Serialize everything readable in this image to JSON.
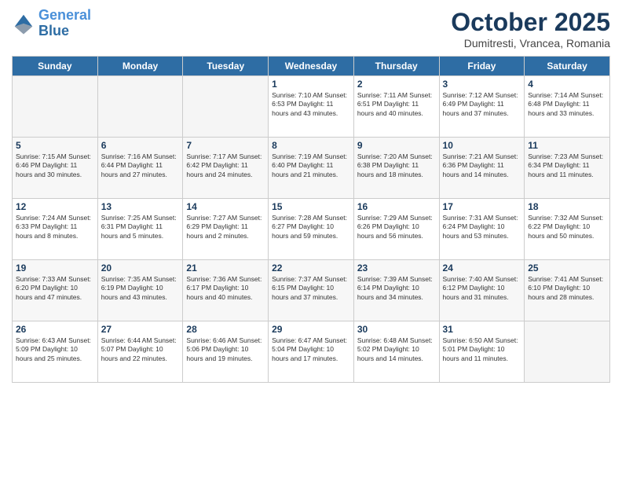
{
  "logo": {
    "line1": "General",
    "line2": "Blue"
  },
  "title": "October 2025",
  "subtitle": "Dumitresti, Vrancea, Romania",
  "days_of_week": [
    "Sunday",
    "Monday",
    "Tuesday",
    "Wednesday",
    "Thursday",
    "Friday",
    "Saturday"
  ],
  "weeks": [
    [
      {
        "num": "",
        "empty": true
      },
      {
        "num": "",
        "empty": true
      },
      {
        "num": "",
        "empty": true
      },
      {
        "num": "1",
        "info": "Sunrise: 7:10 AM\nSunset: 6:53 PM\nDaylight: 11 hours\nand 43 minutes."
      },
      {
        "num": "2",
        "info": "Sunrise: 7:11 AM\nSunset: 6:51 PM\nDaylight: 11 hours\nand 40 minutes."
      },
      {
        "num": "3",
        "info": "Sunrise: 7:12 AM\nSunset: 6:49 PM\nDaylight: 11 hours\nand 37 minutes."
      },
      {
        "num": "4",
        "info": "Sunrise: 7:14 AM\nSunset: 6:48 PM\nDaylight: 11 hours\nand 33 minutes."
      }
    ],
    [
      {
        "num": "5",
        "info": "Sunrise: 7:15 AM\nSunset: 6:46 PM\nDaylight: 11 hours\nand 30 minutes."
      },
      {
        "num": "6",
        "info": "Sunrise: 7:16 AM\nSunset: 6:44 PM\nDaylight: 11 hours\nand 27 minutes."
      },
      {
        "num": "7",
        "info": "Sunrise: 7:17 AM\nSunset: 6:42 PM\nDaylight: 11 hours\nand 24 minutes."
      },
      {
        "num": "8",
        "info": "Sunrise: 7:19 AM\nSunset: 6:40 PM\nDaylight: 11 hours\nand 21 minutes."
      },
      {
        "num": "9",
        "info": "Sunrise: 7:20 AM\nSunset: 6:38 PM\nDaylight: 11 hours\nand 18 minutes."
      },
      {
        "num": "10",
        "info": "Sunrise: 7:21 AM\nSunset: 6:36 PM\nDaylight: 11 hours\nand 14 minutes."
      },
      {
        "num": "11",
        "info": "Sunrise: 7:23 AM\nSunset: 6:34 PM\nDaylight: 11 hours\nand 11 minutes."
      }
    ],
    [
      {
        "num": "12",
        "info": "Sunrise: 7:24 AM\nSunset: 6:33 PM\nDaylight: 11 hours\nand 8 minutes."
      },
      {
        "num": "13",
        "info": "Sunrise: 7:25 AM\nSunset: 6:31 PM\nDaylight: 11 hours\nand 5 minutes."
      },
      {
        "num": "14",
        "info": "Sunrise: 7:27 AM\nSunset: 6:29 PM\nDaylight: 11 hours\nand 2 minutes."
      },
      {
        "num": "15",
        "info": "Sunrise: 7:28 AM\nSunset: 6:27 PM\nDaylight: 10 hours\nand 59 minutes."
      },
      {
        "num": "16",
        "info": "Sunrise: 7:29 AM\nSunset: 6:26 PM\nDaylight: 10 hours\nand 56 minutes."
      },
      {
        "num": "17",
        "info": "Sunrise: 7:31 AM\nSunset: 6:24 PM\nDaylight: 10 hours\nand 53 minutes."
      },
      {
        "num": "18",
        "info": "Sunrise: 7:32 AM\nSunset: 6:22 PM\nDaylight: 10 hours\nand 50 minutes."
      }
    ],
    [
      {
        "num": "19",
        "info": "Sunrise: 7:33 AM\nSunset: 6:20 PM\nDaylight: 10 hours\nand 47 minutes."
      },
      {
        "num": "20",
        "info": "Sunrise: 7:35 AM\nSunset: 6:19 PM\nDaylight: 10 hours\nand 43 minutes."
      },
      {
        "num": "21",
        "info": "Sunrise: 7:36 AM\nSunset: 6:17 PM\nDaylight: 10 hours\nand 40 minutes."
      },
      {
        "num": "22",
        "info": "Sunrise: 7:37 AM\nSunset: 6:15 PM\nDaylight: 10 hours\nand 37 minutes."
      },
      {
        "num": "23",
        "info": "Sunrise: 7:39 AM\nSunset: 6:14 PM\nDaylight: 10 hours\nand 34 minutes."
      },
      {
        "num": "24",
        "info": "Sunrise: 7:40 AM\nSunset: 6:12 PM\nDaylight: 10 hours\nand 31 minutes."
      },
      {
        "num": "25",
        "info": "Sunrise: 7:41 AM\nSunset: 6:10 PM\nDaylight: 10 hours\nand 28 minutes."
      }
    ],
    [
      {
        "num": "26",
        "info": "Sunrise: 6:43 AM\nSunset: 5:09 PM\nDaylight: 10 hours\nand 25 minutes."
      },
      {
        "num": "27",
        "info": "Sunrise: 6:44 AM\nSunset: 5:07 PM\nDaylight: 10 hours\nand 22 minutes."
      },
      {
        "num": "28",
        "info": "Sunrise: 6:46 AM\nSunset: 5:06 PM\nDaylight: 10 hours\nand 19 minutes."
      },
      {
        "num": "29",
        "info": "Sunrise: 6:47 AM\nSunset: 5:04 PM\nDaylight: 10 hours\nand 17 minutes."
      },
      {
        "num": "30",
        "info": "Sunrise: 6:48 AM\nSunset: 5:02 PM\nDaylight: 10 hours\nand 14 minutes."
      },
      {
        "num": "31",
        "info": "Sunrise: 6:50 AM\nSunset: 5:01 PM\nDaylight: 10 hours\nand 11 minutes."
      },
      {
        "num": "",
        "empty": true
      }
    ]
  ]
}
